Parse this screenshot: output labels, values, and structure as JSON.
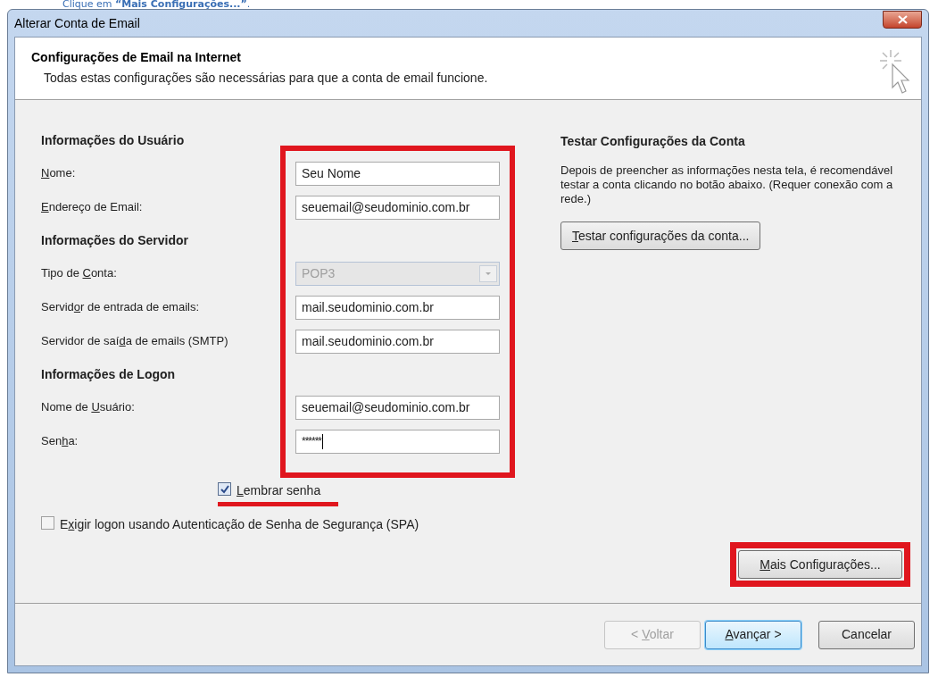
{
  "caption": "Clique em **“Mais Configurações...”**.",
  "window": {
    "title": "Alterar Conta de Email"
  },
  "header": {
    "title": "Configurações de Email na Internet",
    "subtitle": "Todas estas configurações são necessárias para que a conta de email funcione."
  },
  "sections": [
    {
      "heading": "Informações do Usuário",
      "fields": [
        {
          "kind": "text",
          "label": {
            "key": "N",
            "after": "ome:"
          },
          "value": "Seu Nome"
        },
        {
          "kind": "text",
          "label": {
            "key": "E",
            "after": "ndereço de Email:"
          },
          "value": "seuemail@seudominio.com.br"
        }
      ]
    },
    {
      "heading": "Informações do Servidor",
      "fields": [
        {
          "kind": "select",
          "label": {
            "before": "Tipo de ",
            "key": "C",
            "after": "onta:"
          },
          "value": "POP3",
          "disabled": true
        },
        {
          "kind": "text",
          "label": {
            "before": "Servid",
            "key": "o",
            "after": "r de entrada de emails:"
          },
          "value": "mail.seudominio.com.br"
        },
        {
          "kind": "text",
          "label": {
            "before": "Servidor de saí",
            "key": "d",
            "after": "a de emails (SMTP)"
          },
          "value": "mail.seudominio.com.br"
        }
      ]
    },
    {
      "heading": "Informações de Logon",
      "fields": [
        {
          "kind": "text",
          "label": {
            "before": "Nome de ",
            "key": "U",
            "after": "suário:"
          },
          "value": "seuemail@seudominio.com.br"
        },
        {
          "kind": "password",
          "label": {
            "before": "Sen",
            "key": "h",
            "after": "a:"
          },
          "value": "******"
        }
      ]
    }
  ],
  "remember": {
    "label": {
      "key": "L",
      "after": "embrar senha"
    },
    "checked": true
  },
  "spa": {
    "label": {
      "before": "E",
      "key": "x",
      "after": "igir logon usando Autenticação de Senha de Segurança (SPA)"
    },
    "checked": false
  },
  "test": {
    "heading": "Testar Configurações da Conta",
    "description": "Depois de preencher as informações nesta tela, é recomendável testar a conta clicando no botão abaixo. (Requer conexão com a rede.)",
    "button": {
      "key": "T",
      "after": "estar configurações da conta..."
    }
  },
  "more_button": {
    "key": "M",
    "after": "ais Configurações..."
  },
  "footer_buttons": [
    {
      "label": {
        "before": "< ",
        "key": "V",
        "after": "oltar"
      },
      "disabled": true,
      "default": false
    },
    {
      "label": {
        "key": "A",
        "after": "vançar >"
      },
      "disabled": false,
      "default": true
    },
    {
      "label": {
        "after": "Cancelar"
      },
      "disabled": false,
      "default": false
    }
  ]
}
